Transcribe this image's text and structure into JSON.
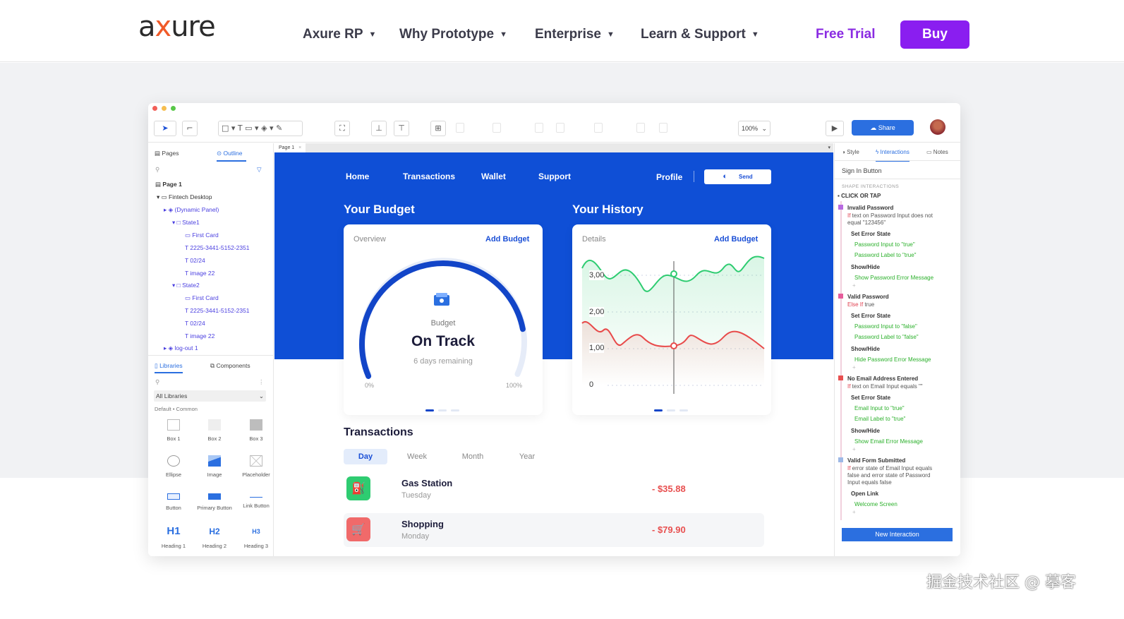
{
  "site": {
    "logo": {
      "a": "a",
      "x": "x",
      "rest": "ure"
    },
    "nav": [
      "Axure RP",
      "Why Prototype",
      "Enterprise",
      "Learn & Support"
    ],
    "caret": "▼",
    "free_trial": "Free Trial",
    "buy": "Buy"
  },
  "app": {
    "toolbar": {
      "zoom": "100%",
      "share": "Share"
    },
    "left_panel": {
      "tabs": [
        "Pages",
        "Outline"
      ],
      "tree": [
        "Page 1",
        "Fintech Desktop",
        "(Dynamic Panel)",
        "State1",
        "First Card",
        "2225-3441-5152-2351",
        "02/24",
        "image 22",
        "State2",
        "First Card",
        "2225-3441-5152-2351",
        "02/24",
        "image 22",
        "log-out 1"
      ],
      "lib_tabs": [
        "Libraries",
        "Components"
      ],
      "lib_select": "All Libraries",
      "lib_filter": "Default • Common",
      "widgets": [
        "Box 1",
        "Box 2",
        "Box 3",
        "Ellipse",
        "Image",
        "Placeholder",
        "Button",
        "Primary Button",
        "Link Button",
        "Heading 1",
        "Heading 2",
        "Heading 3"
      ],
      "heading_glyphs": [
        "H1",
        "H2",
        "H3"
      ]
    },
    "canvas": {
      "page_tab": "Page 1",
      "nav": [
        "Home",
        "Transactions",
        "Wallet",
        "Support"
      ],
      "profile": "Profile",
      "send": "Send",
      "budget": {
        "title": "Your Budget",
        "label": "Overview",
        "link": "Add Budget",
        "caption": "Budget",
        "status": "On Track",
        "remaining": "6 days remaining",
        "min": "0%",
        "max": "100%",
        "progress": 0.85
      },
      "history": {
        "title": "Your History",
        "label": "Details",
        "link": "Add Budget",
        "ticks": [
          "3,00",
          "2,00",
          "1,00",
          "0"
        ]
      },
      "transactions": {
        "title": "Transactions",
        "tabs": [
          "Day",
          "Week",
          "Month",
          "Year"
        ],
        "rows": [
          {
            "name": "Gas Station",
            "day": "Tuesday",
            "amount": "- $35.88",
            "color": "#2ecc71"
          },
          {
            "name": "Shopping",
            "day": "Monday",
            "amount": "- $79.90",
            "color": "#f06a6a"
          }
        ]
      }
    },
    "right_panel": {
      "tabs": [
        "Style",
        "Interactions",
        "Notes"
      ],
      "widget_name": "Sign In Button",
      "section": "SHAPE INTERACTIONS",
      "event": "CLICK OR TAP",
      "cases": [
        {
          "title": "Invalid Password",
          "if": "If text on Password Input does not",
          "if2": "equal \"123456\"",
          "actions": [
            {
              "name": "Set Error State",
              "items": [
                "Password Input to \"true\"",
                "Password Label to \"true\""
              ]
            },
            {
              "name": "Show/Hide",
              "items": [
                "Show Password Error Message"
              ]
            }
          ]
        },
        {
          "title": "Valid Password",
          "if": "Else If true",
          "if2": "",
          "actions": [
            {
              "name": "Set Error State",
              "items": [
                "Password Input to \"false\"",
                "Password Label to \"false\""
              ]
            },
            {
              "name": "Show/Hide",
              "items": [
                "Hide Password Error Message"
              ]
            }
          ]
        },
        {
          "title": "No Email Address Entered",
          "if": "If text on Email Input equals \"\"",
          "if2": "",
          "actions": [
            {
              "name": "Set Error State",
              "items": [
                "Email Input to \"true\"",
                "Email Label to \"true\""
              ]
            },
            {
              "name": "Show/Hide",
              "items": [
                "Show Email Error Message"
              ]
            }
          ]
        },
        {
          "title": "Valid Form Submitted",
          "if": "If error state of Email Input equals",
          "if2": "false and error state of Password",
          "if3": "Input equals false",
          "actions": [
            {
              "name": "Open Link",
              "items": [
                "Welcome Screen"
              ]
            }
          ]
        }
      ],
      "new_interaction": "New Interaction"
    }
  },
  "watermark": "掘金技术社区 @ 摹客",
  "colors": {
    "brand_purple": "#8a1ef0",
    "app_blue": "#0f4fd6",
    "positive": "#2ecc71",
    "negative": "#e85050"
  }
}
